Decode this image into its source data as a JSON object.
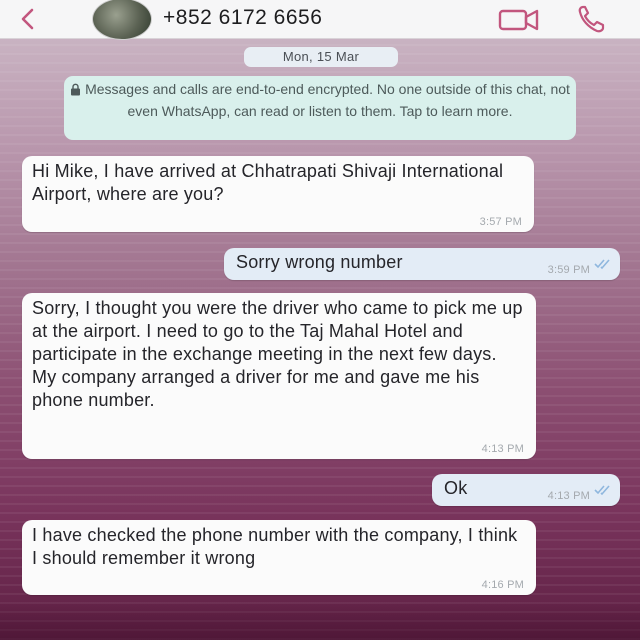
{
  "header": {
    "contact_number": "+852 6172 6656",
    "back_icon": "chevron-left-icon",
    "video_icon": "video-camera-icon",
    "call_icon": "phone-icon",
    "accent_color": "#c2567e"
  },
  "chat": {
    "date_label": "Mon, 15 Mar",
    "encryption_notice": "Messages and calls are end-to-end encrypted. No one outside of this chat, not even WhatsApp, can read or listen to them. Tap to learn more.",
    "encryption_icon": "lock-icon",
    "messages": [
      {
        "direction": "incoming",
        "text": "Hi Mike, I have arrived at Chhatrapati Shivaji International Airport, where are you?",
        "time": "3:57 PM"
      },
      {
        "direction": "outgoing",
        "text": "Sorry wrong number",
        "time": "3:59 PM",
        "status_icon": "double-check-icon"
      },
      {
        "direction": "incoming",
        "text": "Sorry, I thought you were the driver who came to pick me up at the airport. I need to go to the Taj Mahal Hotel and participate in the exchange meeting in the next few days. My company arranged a driver for me and gave me his phone number.",
        "time": "4:13 PM"
      },
      {
        "direction": "outgoing",
        "text": "Ok",
        "time": "4:13 PM",
        "status_icon": "double-check-icon"
      },
      {
        "direction": "incoming",
        "text": "I have checked the phone number with the company, I think I should remember it wrong",
        "time": "4:16 PM"
      }
    ]
  },
  "colors": {
    "incoming_bubble": "#fbfbfb",
    "outgoing_bubble": "#e3ecf6",
    "encryption_bubble": "#d9f0ec",
    "read_ticks": "#8fb7de"
  }
}
